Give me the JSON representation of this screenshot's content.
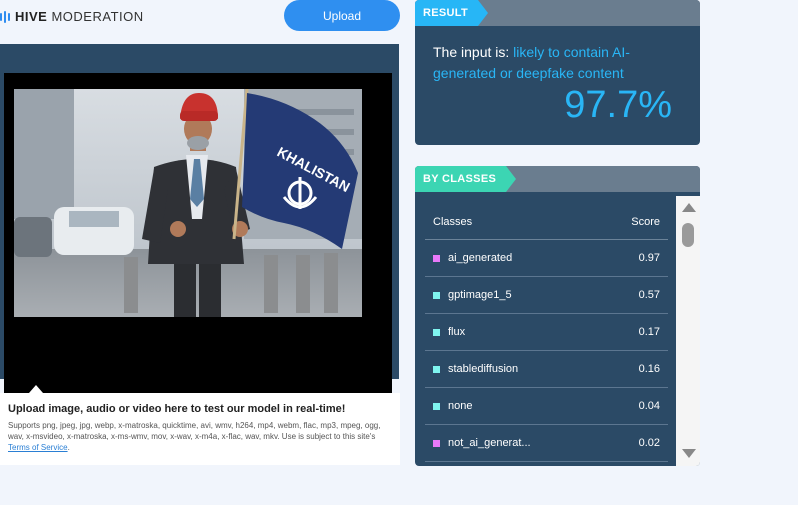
{
  "brand": {
    "bold": "HIVE",
    "rest": "MODERATION",
    "color": "#2e8cf0"
  },
  "toolbar": {
    "upload_label": "Upload"
  },
  "media": {
    "flag_text": "KHALISTAN",
    "description_icon": "photo-of-man-holding-flag"
  },
  "upload_info": {
    "title": "Upload image, audio or video here to test our model in real-time!",
    "formats": "Supports png, jpeg, jpg, webp, x-matroska, quicktime, avi, wmv, h264, mp4, webm, flac, mp3, mpeg, ogg, wav, x-msvideo, x-matroska, x-ms-wmv, mov, x-wav, x-m4a, x-flac, wav, mkv. Use is subject to this site's",
    "terms_link": "Terms of Service",
    "period": "."
  },
  "result": {
    "tag": "RESULT",
    "prefix": "The input is: ",
    "verdict": "likely to contain AI-generated or deepfake content",
    "percent": "97.7%",
    "accent": "#29b6f6"
  },
  "classes": {
    "tag": "BY CLASSES",
    "col_class": "Classes",
    "col_score": "Score",
    "rows": [
      {
        "name": "ai_generated",
        "score": "0.97",
        "color": "#e879f9"
      },
      {
        "name": "gptimage1_5",
        "score": "0.57",
        "color": "#7ff5f0"
      },
      {
        "name": "flux",
        "score": "0.17",
        "color": "#7ff5f0"
      },
      {
        "name": "stablediffusion",
        "score": "0.16",
        "color": "#7ff5f0"
      },
      {
        "name": "none",
        "score": "0.04",
        "color": "#7ff5f0"
      },
      {
        "name": "not_ai_generat...",
        "score": "0.02",
        "color": "#e879f9"
      }
    ]
  }
}
